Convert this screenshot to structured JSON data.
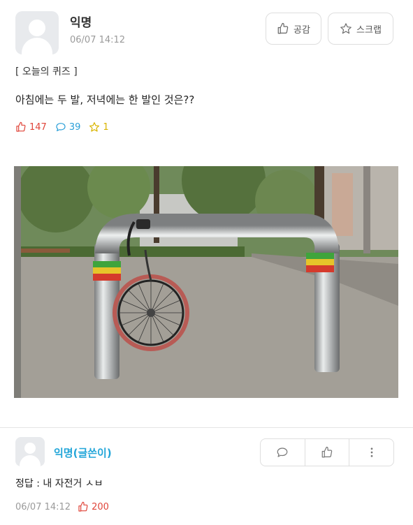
{
  "post": {
    "author": "익명",
    "date": "06/07 14:12",
    "like_button_label": "공감",
    "scrap_button_label": "스크랩",
    "quiz_tag": "[ 오늘의 퀴즈 ]",
    "question": "아침에는 두 발, 저녁에는 한 발인 것은??",
    "stats": {
      "likes": "147",
      "comments": "39",
      "scraps": "1"
    },
    "image": {
      "description_icon": "photo-bicycle-wheel-locked-to-rack"
    }
  },
  "comment": {
    "author": "익명(글쓴이)",
    "text": "정답 : 내 자전거 ㅅㅂ",
    "date": "06/07 14:12",
    "likes": "200"
  },
  "colors": {
    "like_red": "#e0453a",
    "comment_blue": "#2a9fd8",
    "scrap_yellow": "#d9b400",
    "writer_blue": "#23a6d9"
  }
}
